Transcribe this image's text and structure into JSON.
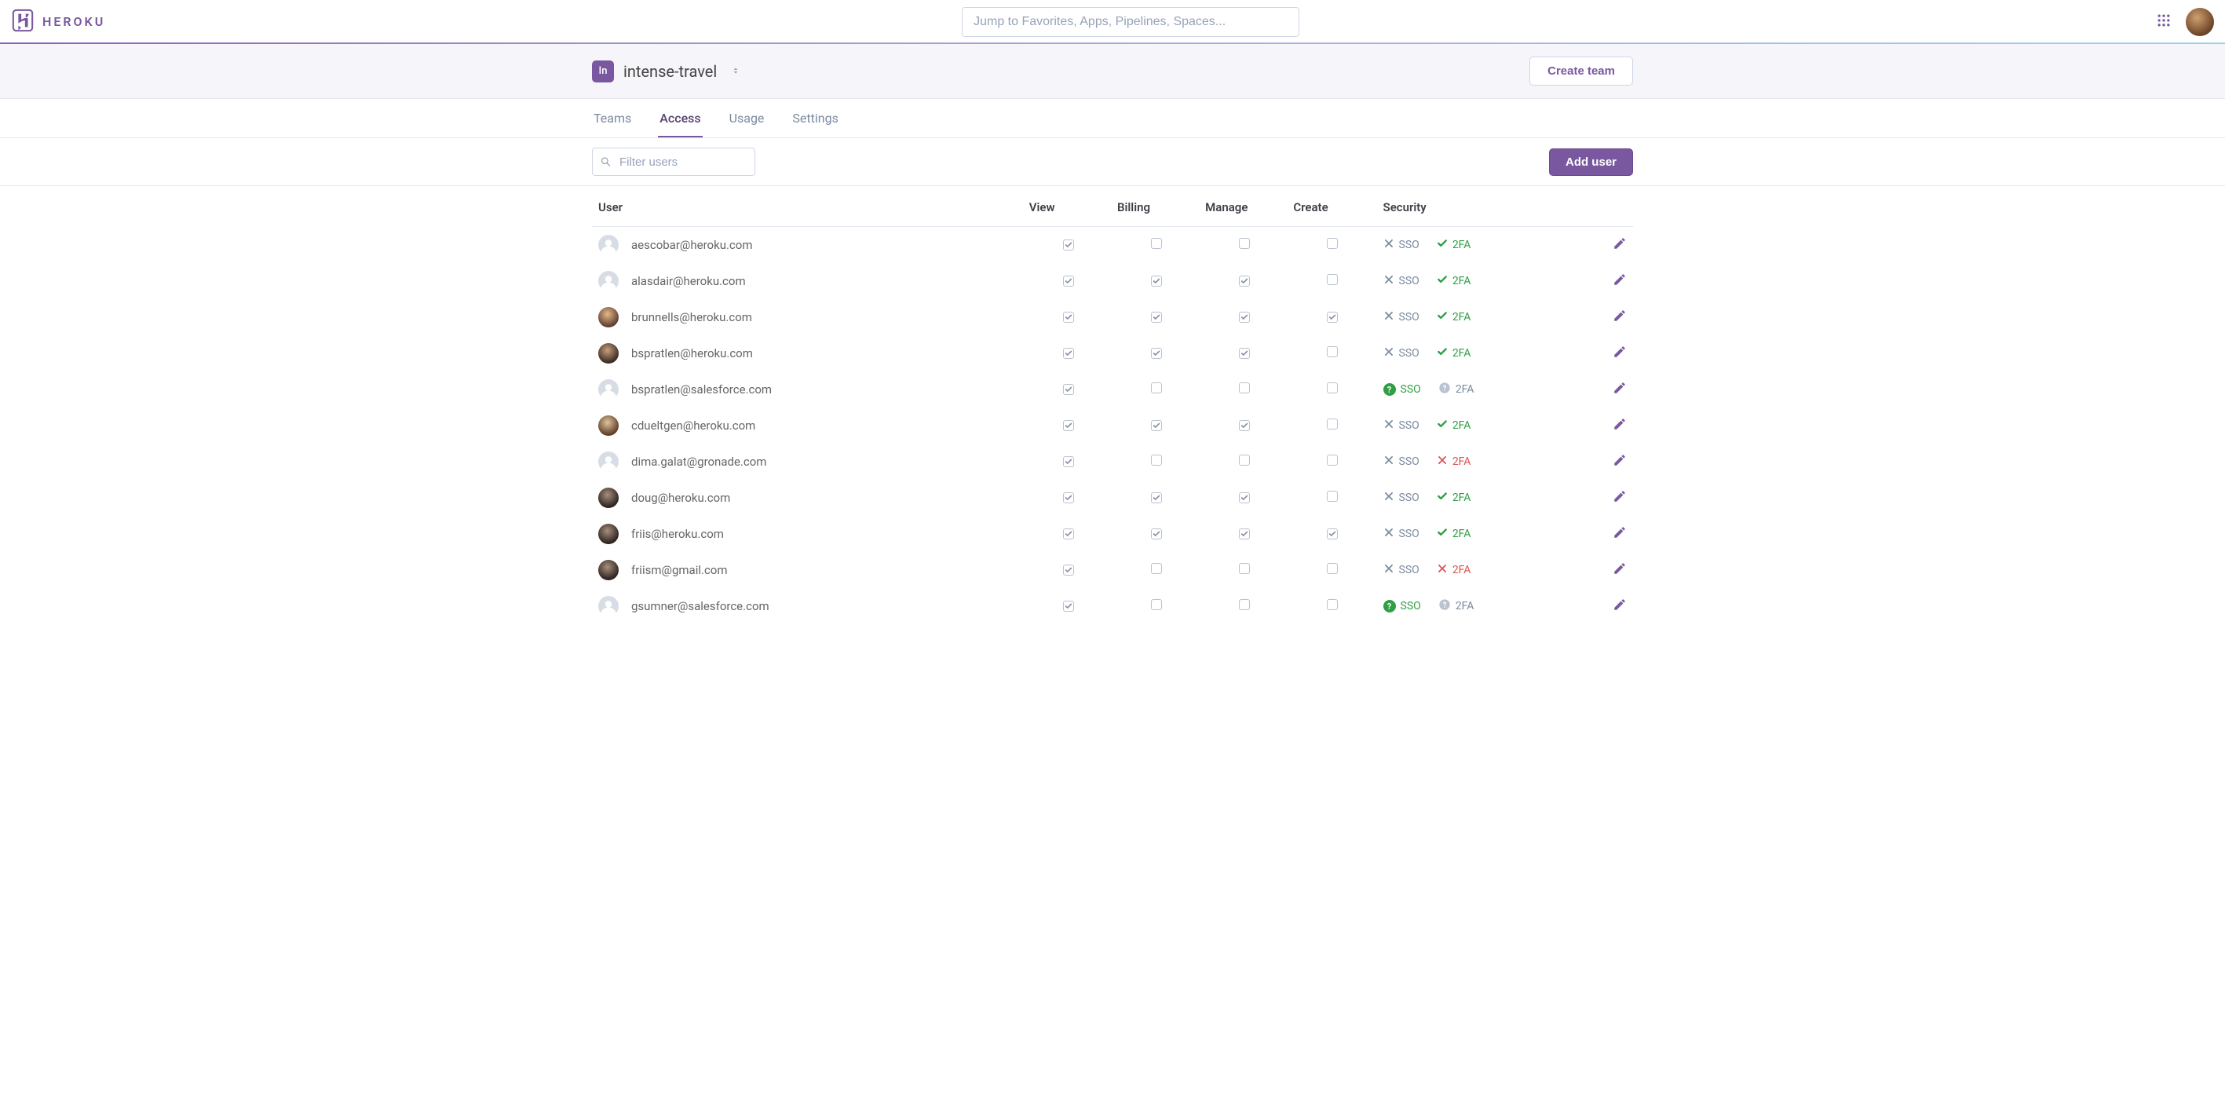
{
  "brand": {
    "text": "HEROKU"
  },
  "search": {
    "placeholder": "Jump to Favorites, Apps, Pipelines, Spaces..."
  },
  "team": {
    "abbrev": "In",
    "name": "intense-travel"
  },
  "buttons": {
    "create_team": "Create team",
    "add_user": "Add user"
  },
  "tabs": [
    {
      "label": "Teams",
      "active": false
    },
    {
      "label": "Access",
      "active": true
    },
    {
      "label": "Usage",
      "active": false
    },
    {
      "label": "Settings",
      "active": false
    }
  ],
  "filter": {
    "placeholder": "Filter users"
  },
  "columns": {
    "user": "User",
    "view": "View",
    "billing": "Billing",
    "manage": "Manage",
    "create": "Create",
    "security": "Security"
  },
  "security_labels": {
    "sso": "SSO",
    "tfa": "2FA"
  },
  "users": [
    {
      "email": "aescobar@heroku.com",
      "avatar": "placeholder",
      "view": true,
      "billing": false,
      "manage": false,
      "create": false,
      "sso": "no",
      "tfa": "on"
    },
    {
      "email": "alasdair@heroku.com",
      "avatar": "placeholder",
      "view": true,
      "billing": true,
      "manage": true,
      "create": false,
      "sso": "no",
      "tfa": "on"
    },
    {
      "email": "brunnells@heroku.com",
      "avatar": "photo",
      "view": true,
      "billing": true,
      "manage": true,
      "create": true,
      "sso": "no",
      "tfa": "on"
    },
    {
      "email": "bspratlen@heroku.com",
      "avatar": "photo alt1",
      "view": true,
      "billing": true,
      "manage": true,
      "create": false,
      "sso": "no",
      "tfa": "on"
    },
    {
      "email": "bspratlen@salesforce.com",
      "avatar": "placeholder",
      "view": true,
      "billing": false,
      "manage": false,
      "create": false,
      "sso": "unknown",
      "tfa": "unknown"
    },
    {
      "email": "cdueltgen@heroku.com",
      "avatar": "photo alt3",
      "view": true,
      "billing": true,
      "manage": true,
      "create": false,
      "sso": "no",
      "tfa": "on"
    },
    {
      "email": "dima.galat@gronade.com",
      "avatar": "placeholder",
      "view": true,
      "billing": false,
      "manage": false,
      "create": false,
      "sso": "no",
      "tfa": "off"
    },
    {
      "email": "doug@heroku.com",
      "avatar": "photo alt2",
      "view": true,
      "billing": true,
      "manage": true,
      "create": false,
      "sso": "no",
      "tfa": "on"
    },
    {
      "email": "friis@heroku.com",
      "avatar": "photo alt2",
      "view": true,
      "billing": true,
      "manage": true,
      "create": true,
      "sso": "no",
      "tfa": "on"
    },
    {
      "email": "friism@gmail.com",
      "avatar": "photo alt2",
      "view": true,
      "billing": false,
      "manage": false,
      "create": false,
      "sso": "no",
      "tfa": "off"
    },
    {
      "email": "gsumner@salesforce.com",
      "avatar": "placeholder",
      "view": true,
      "billing": false,
      "manage": false,
      "create": false,
      "sso": "unknown",
      "tfa": "unknown"
    }
  ]
}
